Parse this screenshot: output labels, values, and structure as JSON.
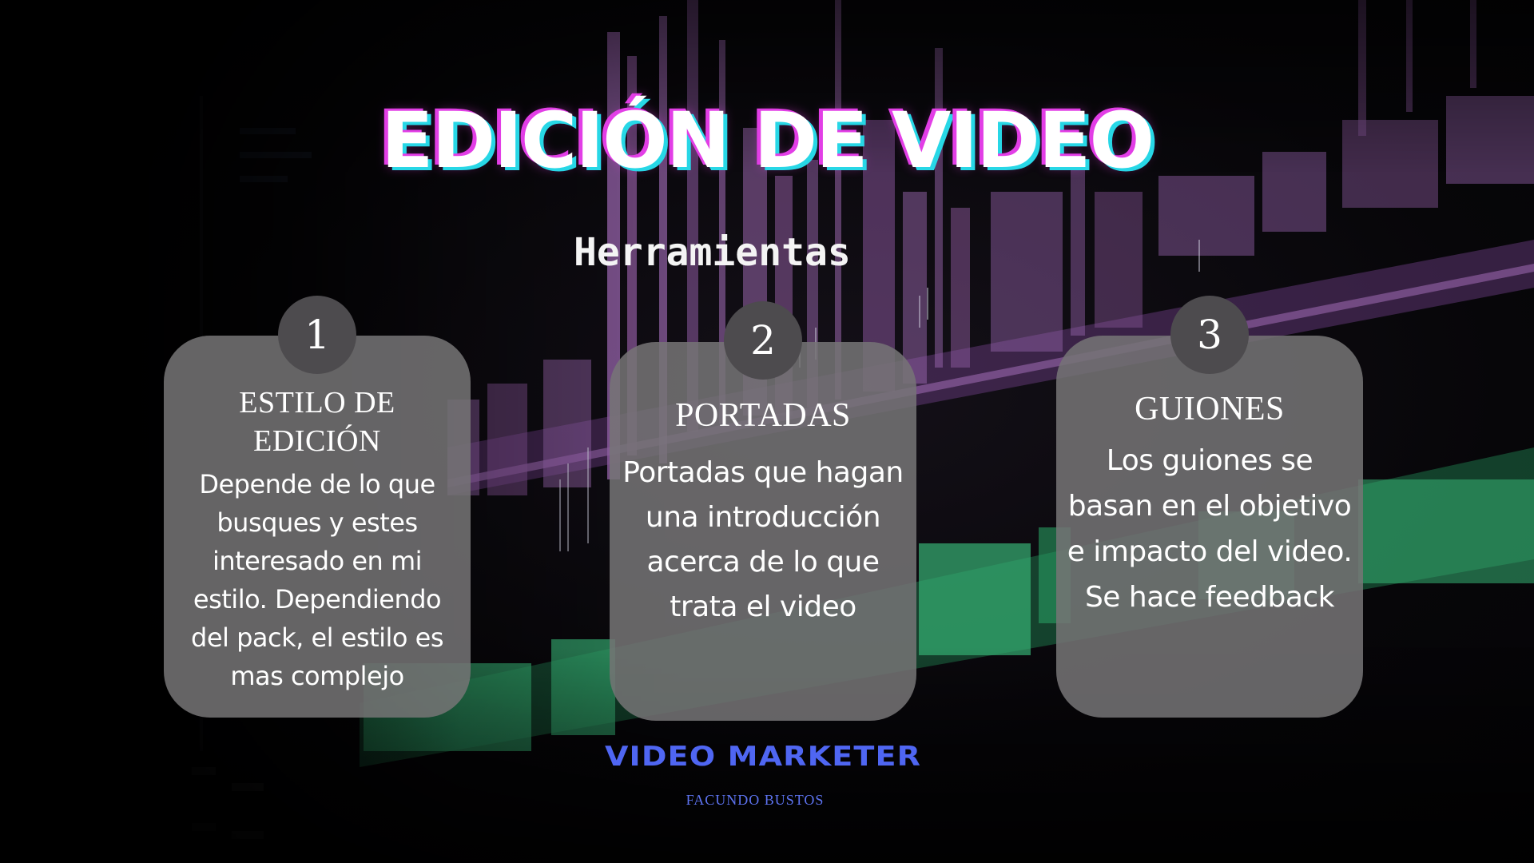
{
  "title": "EDICIÓN DE VIDEO",
  "subtitle": "Herramientas",
  "cards": [
    {
      "number": "1",
      "title_line1": "ESTILO DE",
      "title_line2": "EDICIÓN",
      "text": "Depende de lo que busques y estes interesado en mi estilo. Dependiendo del pack, el estilo es mas complejo"
    },
    {
      "number": "2",
      "title": "PORTADAS",
      "text": "Portadas que hagan una introducción acerca de lo que trata el video"
    },
    {
      "number": "3",
      "title": "GUIONES",
      "text": "Los guiones se basan en el objetivo e impacto del video. Se hace feedback"
    }
  ],
  "footer": {
    "brand": "VIDEO MARKETER",
    "author": "FACUNDO BUSTOS"
  },
  "colors": {
    "title_magenta": "#e23ee6",
    "title_cyan": "#27d7e6",
    "card_bg": "#767476",
    "badge_bg": "#4d4b4e",
    "brand_blue": "#4f66f2",
    "clip_purple": "#b276c9",
    "clip_green": "#3fcf86"
  }
}
